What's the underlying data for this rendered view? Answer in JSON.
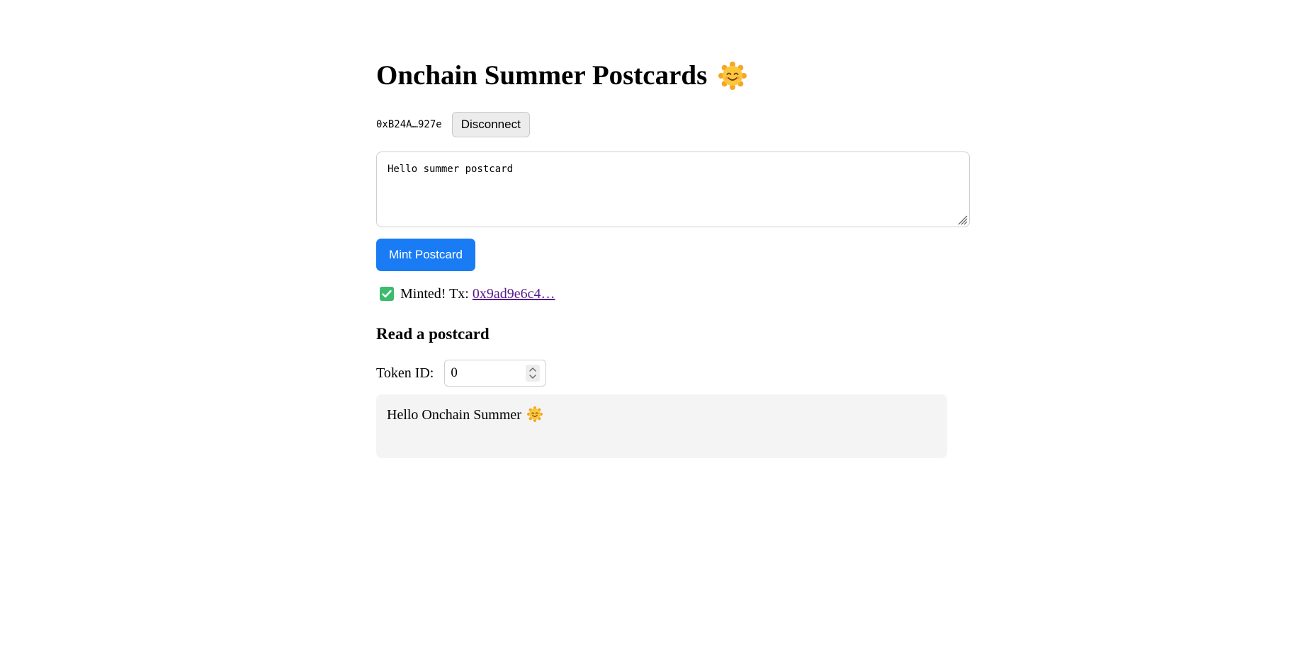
{
  "header": {
    "title": "Onchain Summer Postcards",
    "title_icon": "smiling-sun-icon"
  },
  "wallet": {
    "address": "0xB24A…927e",
    "disconnect_label": "Disconnect"
  },
  "composer": {
    "message_value": "Hello summer postcard",
    "mint_label": "Mint Postcard"
  },
  "status": {
    "icon": "check-mark-icon",
    "text": "Minted! Tx:",
    "tx_link": "0x9ad9e6c4…"
  },
  "reader": {
    "heading": "Read a postcard",
    "token_label": "Token ID:",
    "token_value": "0",
    "result_text": "Hello Onchain Summer",
    "result_icon": "smiling-sun-icon"
  },
  "colors": {
    "accent": "#1a7cf5",
    "link_visited": "#551a8b",
    "check_green": "#3dbb6e",
    "sun_orange": "#f5a623",
    "result_bg": "#f4f4f4"
  }
}
